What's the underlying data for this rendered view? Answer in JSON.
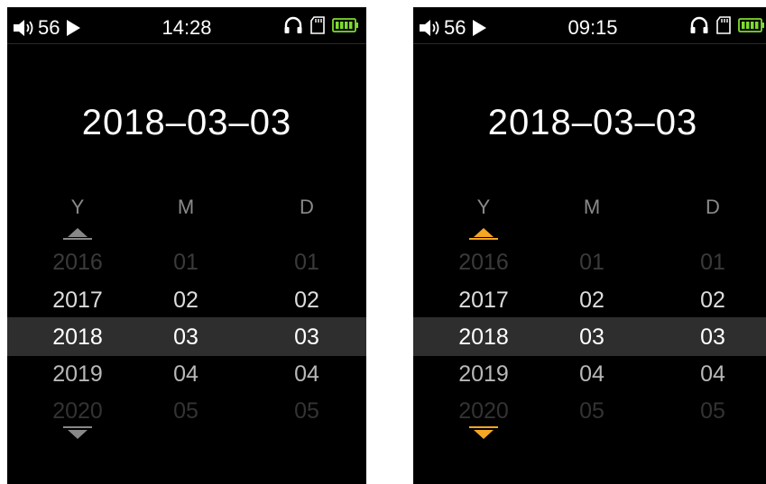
{
  "colors": {
    "background": "#000000",
    "text": "#ffffff",
    "selection_band": "#2e2e2e",
    "battery": "#7ddc2f",
    "arrow_inactive": "#888888",
    "arrow_active": "#f5a623"
  },
  "icons": [
    "speaker-icon",
    "play-icon",
    "headphone-icon",
    "sd-card-icon",
    "battery-icon",
    "triangle-up-icon",
    "triangle-down-icon"
  ],
  "screens": [
    {
      "status": {
        "volume": "56",
        "time": "14:28"
      },
      "date": "2018–03–03",
      "columns": {
        "year": "Y",
        "month": "M",
        "day": "D"
      },
      "rows": [
        {
          "year": "2016",
          "month": "01",
          "day": "01"
        },
        {
          "year": "2017",
          "month": "02",
          "day": "02"
        },
        {
          "year": "2018",
          "month": "03",
          "day": "03"
        },
        {
          "year": "2019",
          "month": "04",
          "day": "04"
        },
        {
          "year": "2020",
          "month": "05",
          "day": "05"
        }
      ],
      "arrow_color": "#888888"
    },
    {
      "status": {
        "volume": "56",
        "time": "09:15"
      },
      "date": "2018–03–03",
      "columns": {
        "year": "Y",
        "month": "M",
        "day": "D"
      },
      "rows": [
        {
          "year": "2016",
          "month": "01",
          "day": "01"
        },
        {
          "year": "2017",
          "month": "02",
          "day": "02"
        },
        {
          "year": "2018",
          "month": "03",
          "day": "03"
        },
        {
          "year": "2019",
          "month": "04",
          "day": "04"
        },
        {
          "year": "2020",
          "month": "05",
          "day": "05"
        }
      ],
      "arrow_color": "#f5a623"
    }
  ]
}
